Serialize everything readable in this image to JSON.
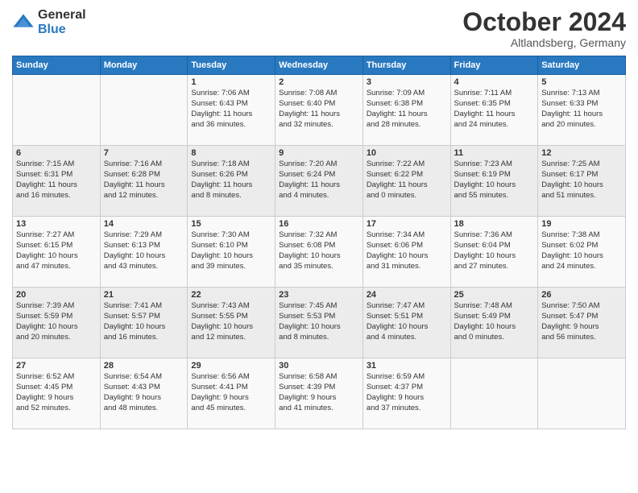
{
  "logo": {
    "line1": "General",
    "line2": "Blue"
  },
  "title": "October 2024",
  "subtitle": "Altlandsberg, Germany",
  "days_header": [
    "Sunday",
    "Monday",
    "Tuesday",
    "Wednesday",
    "Thursday",
    "Friday",
    "Saturday"
  ],
  "weeks": [
    [
      {
        "day": "",
        "info": ""
      },
      {
        "day": "",
        "info": ""
      },
      {
        "day": "1",
        "info": "Sunrise: 7:06 AM\nSunset: 6:43 PM\nDaylight: 11 hours\nand 36 minutes."
      },
      {
        "day": "2",
        "info": "Sunrise: 7:08 AM\nSunset: 6:40 PM\nDaylight: 11 hours\nand 32 minutes."
      },
      {
        "day": "3",
        "info": "Sunrise: 7:09 AM\nSunset: 6:38 PM\nDaylight: 11 hours\nand 28 minutes."
      },
      {
        "day": "4",
        "info": "Sunrise: 7:11 AM\nSunset: 6:35 PM\nDaylight: 11 hours\nand 24 minutes."
      },
      {
        "day": "5",
        "info": "Sunrise: 7:13 AM\nSunset: 6:33 PM\nDaylight: 11 hours\nand 20 minutes."
      }
    ],
    [
      {
        "day": "6",
        "info": "Sunrise: 7:15 AM\nSunset: 6:31 PM\nDaylight: 11 hours\nand 16 minutes."
      },
      {
        "day": "7",
        "info": "Sunrise: 7:16 AM\nSunset: 6:28 PM\nDaylight: 11 hours\nand 12 minutes."
      },
      {
        "day": "8",
        "info": "Sunrise: 7:18 AM\nSunset: 6:26 PM\nDaylight: 11 hours\nand 8 minutes."
      },
      {
        "day": "9",
        "info": "Sunrise: 7:20 AM\nSunset: 6:24 PM\nDaylight: 11 hours\nand 4 minutes."
      },
      {
        "day": "10",
        "info": "Sunrise: 7:22 AM\nSunset: 6:22 PM\nDaylight: 11 hours\nand 0 minutes."
      },
      {
        "day": "11",
        "info": "Sunrise: 7:23 AM\nSunset: 6:19 PM\nDaylight: 10 hours\nand 55 minutes."
      },
      {
        "day": "12",
        "info": "Sunrise: 7:25 AM\nSunset: 6:17 PM\nDaylight: 10 hours\nand 51 minutes."
      }
    ],
    [
      {
        "day": "13",
        "info": "Sunrise: 7:27 AM\nSunset: 6:15 PM\nDaylight: 10 hours\nand 47 minutes."
      },
      {
        "day": "14",
        "info": "Sunrise: 7:29 AM\nSunset: 6:13 PM\nDaylight: 10 hours\nand 43 minutes."
      },
      {
        "day": "15",
        "info": "Sunrise: 7:30 AM\nSunset: 6:10 PM\nDaylight: 10 hours\nand 39 minutes."
      },
      {
        "day": "16",
        "info": "Sunrise: 7:32 AM\nSunset: 6:08 PM\nDaylight: 10 hours\nand 35 minutes."
      },
      {
        "day": "17",
        "info": "Sunrise: 7:34 AM\nSunset: 6:06 PM\nDaylight: 10 hours\nand 31 minutes."
      },
      {
        "day": "18",
        "info": "Sunrise: 7:36 AM\nSunset: 6:04 PM\nDaylight: 10 hours\nand 27 minutes."
      },
      {
        "day": "19",
        "info": "Sunrise: 7:38 AM\nSunset: 6:02 PM\nDaylight: 10 hours\nand 24 minutes."
      }
    ],
    [
      {
        "day": "20",
        "info": "Sunrise: 7:39 AM\nSunset: 5:59 PM\nDaylight: 10 hours\nand 20 minutes."
      },
      {
        "day": "21",
        "info": "Sunrise: 7:41 AM\nSunset: 5:57 PM\nDaylight: 10 hours\nand 16 minutes."
      },
      {
        "day": "22",
        "info": "Sunrise: 7:43 AM\nSunset: 5:55 PM\nDaylight: 10 hours\nand 12 minutes."
      },
      {
        "day": "23",
        "info": "Sunrise: 7:45 AM\nSunset: 5:53 PM\nDaylight: 10 hours\nand 8 minutes."
      },
      {
        "day": "24",
        "info": "Sunrise: 7:47 AM\nSunset: 5:51 PM\nDaylight: 10 hours\nand 4 minutes."
      },
      {
        "day": "25",
        "info": "Sunrise: 7:48 AM\nSunset: 5:49 PM\nDaylight: 10 hours\nand 0 minutes."
      },
      {
        "day": "26",
        "info": "Sunrise: 7:50 AM\nSunset: 5:47 PM\nDaylight: 9 hours\nand 56 minutes."
      }
    ],
    [
      {
        "day": "27",
        "info": "Sunrise: 6:52 AM\nSunset: 4:45 PM\nDaylight: 9 hours\nand 52 minutes."
      },
      {
        "day": "28",
        "info": "Sunrise: 6:54 AM\nSunset: 4:43 PM\nDaylight: 9 hours\nand 48 minutes."
      },
      {
        "day": "29",
        "info": "Sunrise: 6:56 AM\nSunset: 4:41 PM\nDaylight: 9 hours\nand 45 minutes."
      },
      {
        "day": "30",
        "info": "Sunrise: 6:58 AM\nSunset: 4:39 PM\nDaylight: 9 hours\nand 41 minutes."
      },
      {
        "day": "31",
        "info": "Sunrise: 6:59 AM\nSunset: 4:37 PM\nDaylight: 9 hours\nand 37 minutes."
      },
      {
        "day": "",
        "info": ""
      },
      {
        "day": "",
        "info": ""
      }
    ]
  ]
}
